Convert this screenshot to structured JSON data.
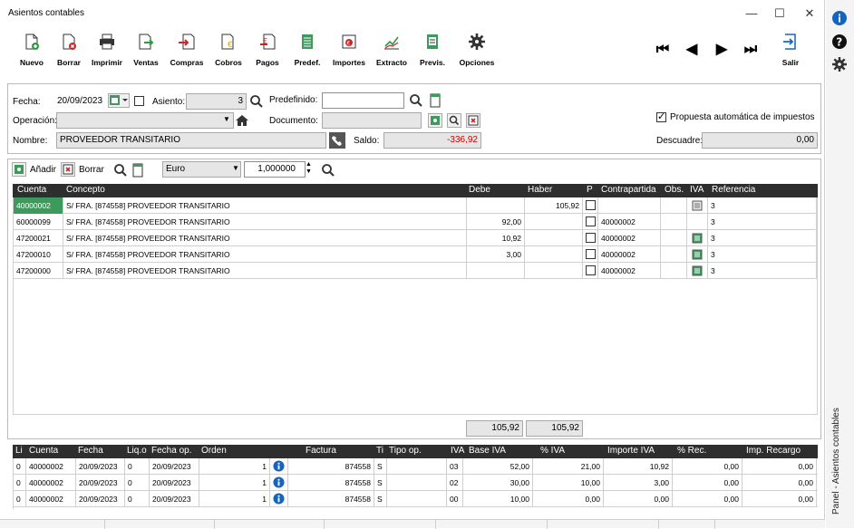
{
  "window": {
    "title": "Asientos contables",
    "controls": [
      "—",
      "☐",
      "✕"
    ]
  },
  "toolbar": {
    "buttons": [
      "Nuevo",
      "Borrar",
      "Imprimir",
      "Ventas",
      "Compras",
      "Cobros",
      "Pagos",
      "Predef.",
      "Importes",
      "Extracto",
      "Previs.",
      "Opciones"
    ],
    "exit_label": "Salir"
  },
  "header": {
    "fecha_label": "Fecha:",
    "fecha_value": "20/09/2023",
    "asiento_label": "Asiento:",
    "asiento_value": "3",
    "predefinido_label": "Predefinido:",
    "predefinido_value": "",
    "operacion_label": "Operación:",
    "operacion_value": "",
    "documento_label": "Documento:",
    "documento_value": "",
    "propuesta_label": "Propuesta automática de impuestos",
    "propuesta_checked": true,
    "nombre_label": "Nombre:",
    "nombre_value": "PROVEEDOR TRANSITARIO",
    "saldo_label": "Saldo:",
    "saldo_value": "-336,92",
    "descuadre_label": "Descuadre:",
    "descuadre_value": "0,00"
  },
  "lines_toolbar": {
    "add_label": "Añadir",
    "delete_label": "Borrar",
    "currency": "Euro",
    "rate": "1,000000"
  },
  "lines": {
    "headers": [
      "Cuenta",
      "Concepto",
      "Debe",
      "Haber",
      "P",
      "Contrapartida",
      "Obs.",
      "IVA",
      "Referencia"
    ],
    "rows": [
      {
        "cuenta": "40000002",
        "concepto": "S/ FRA. [874558] PROVEEDOR TRANSITARIO",
        "debe": "",
        "haber": "105,92",
        "contrapartida": "",
        "iva": "doc",
        "ref": "3"
      },
      {
        "cuenta": "60000099",
        "concepto": "S/ FRA. [874558] PROVEEDOR TRANSITARIO",
        "debe": "92,00",
        "haber": "",
        "contrapartida": "40000002",
        "iva": "",
        "ref": "3"
      },
      {
        "cuenta": "47200021",
        "concepto": "S/ FRA. [874558] PROVEEDOR TRANSITARIO",
        "debe": "10,92",
        "haber": "",
        "contrapartida": "40000002",
        "iva": "green",
        "ref": "3"
      },
      {
        "cuenta": "47200010",
        "concepto": "S/ FRA. [874558] PROVEEDOR TRANSITARIO",
        "debe": "3,00",
        "haber": "",
        "contrapartida": "40000002",
        "iva": "green",
        "ref": "3"
      },
      {
        "cuenta": "47200000",
        "concepto": "S/ FRA. [874558] PROVEEDOR TRANSITARIO",
        "debe": "",
        "haber": "",
        "contrapartida": "40000002",
        "iva": "green",
        "ref": "3"
      }
    ],
    "total_debe": "105,92",
    "total_haber": "105,92"
  },
  "vat": {
    "headers": [
      "Li",
      "Cuenta",
      "Fecha",
      "Liq.o",
      "Fecha op.",
      "Orden",
      "Factura",
      "Ti",
      "Tipo op.",
      "IVA",
      "Base IVA",
      "% IVA",
      "Importe IVA",
      "% Rec.",
      "Imp. Recargo"
    ],
    "rows": [
      {
        "li": "0",
        "cuenta": "40000002",
        "fecha": "20/09/2023",
        "liq": "0",
        "fecha_op": "20/09/2023",
        "orden": "1",
        "factura": "874558",
        "ti": "S",
        "tipo_op": "",
        "iva": "03",
        "base": "52,00",
        "pct": "21,00",
        "importe": "10,92",
        "rec": "0,00",
        "recargo": "0,00"
      },
      {
        "li": "0",
        "cuenta": "40000002",
        "fecha": "20/09/2023",
        "liq": "0",
        "fecha_op": "20/09/2023",
        "orden": "1",
        "factura": "874558",
        "ti": "S",
        "tipo_op": "",
        "iva": "02",
        "base": "30,00",
        "pct": "10,00",
        "importe": "3,00",
        "rec": "0,00",
        "recargo": "0,00"
      },
      {
        "li": "0",
        "cuenta": "40000002",
        "fecha": "20/09/2023",
        "liq": "0",
        "fecha_op": "20/09/2023",
        "orden": "1",
        "factura": "874558",
        "ti": "S",
        "tipo_op": "",
        "iva": "00",
        "base": "10,00",
        "pct": "0,00",
        "importe": "0,00",
        "rec": "0,00",
        "recargo": "0,00"
      }
    ]
  },
  "sidebar": {
    "panel_label": "Panel - Asientos contables"
  },
  "colors": {
    "accent": "#1565c0",
    "selected": "#3d9a5c",
    "grid_header": "#2e2e2e",
    "negative": "#d00000"
  }
}
